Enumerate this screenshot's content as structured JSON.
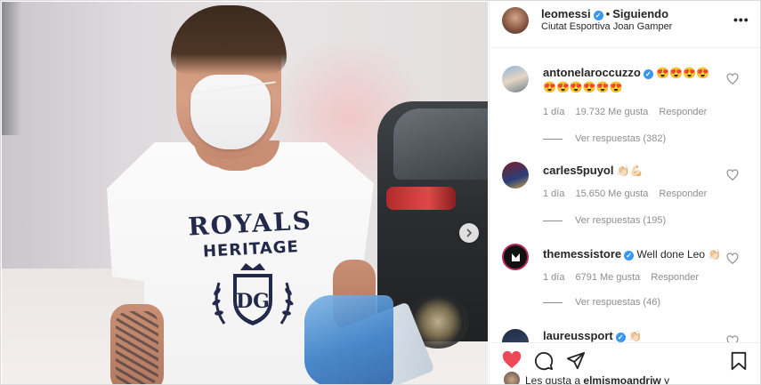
{
  "post": {
    "username": "leomessi",
    "separator": "•",
    "follow_status": "Siguiendo",
    "location": "Ciutat Esportiva Joan Gamper",
    "more_label": "•••",
    "shirt_text_1": "ROYALS",
    "shirt_text_2": "HERITAGE",
    "shirt_crest_text": "DG"
  },
  "comments": [
    {
      "username": "antonelaroccuzzo",
      "text": "😍😍😍😍😍😍😍😍😍😍",
      "time": "1 día",
      "likes": "19.732 Me gusta",
      "reply_label": "Responder",
      "replies": "Ver respuestas (382)"
    },
    {
      "username": "carles5puyol",
      "text": "👏🏻💪🏻",
      "time": "1 día",
      "likes": "15.650 Me gusta",
      "reply_label": "Responder",
      "replies": "Ver respuestas (195)"
    },
    {
      "username": "themessistore",
      "text": "Well done Leo 👏🏻",
      "time": "1 día",
      "likes": "6791 Me gusta",
      "reply_label": "Responder",
      "replies": "Ver respuestas (46)"
    },
    {
      "username": "laureussport",
      "text": "👏🏻"
    }
  ],
  "footer": {
    "likes_prefix": "Les gusta a ",
    "likes_user": "elmismoandriw",
    "likes_suffix": " y"
  },
  "colors": {
    "like_red": "#ed4956",
    "verified_blue": "#3897f0",
    "muted_text": "#8e8e8e"
  },
  "icons": [
    "heart-icon",
    "comment-icon",
    "share-icon",
    "bookmark-icon",
    "chevron-right-icon",
    "verified-icon"
  ]
}
